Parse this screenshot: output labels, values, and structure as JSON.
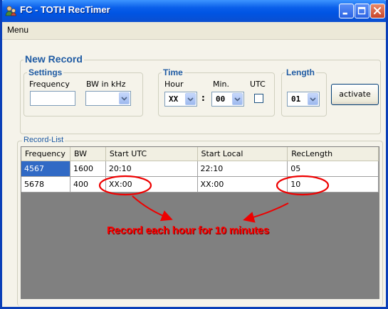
{
  "window": {
    "title": "FC - TOTH RecTimer"
  },
  "menu": {
    "label": "Menu"
  },
  "new_record": {
    "legend": "New Record",
    "settings": {
      "legend": "Settings",
      "frequency_label": "Frequency",
      "frequency_value": "",
      "bw_label": "BW in kHz",
      "bw_value": ""
    },
    "time": {
      "legend": "Time",
      "hour_label": "Hour",
      "hour_value": "XX",
      "min_label": "Min.",
      "min_value": "00",
      "separator": ":",
      "utc_label": "UTC",
      "utc_checked": false
    },
    "length": {
      "legend": "Length",
      "value": "01"
    },
    "activate_label": "activate"
  },
  "record_list": {
    "legend": "Record-List",
    "columns": [
      "Frequency",
      "BW",
      "Start UTC",
      "Start Local",
      "RecLength"
    ],
    "rows": [
      [
        "4567",
        "1600",
        "20:10",
        "22:10",
        "05"
      ],
      [
        "5678",
        "400",
        "XX:00",
        "XX:00",
        "10"
      ]
    ]
  },
  "annotation": {
    "text": "Record each hour for 10 minutes",
    "color": "#ff0000"
  },
  "colors": {
    "titlebar": "#0054e3",
    "selection": "#316ac5",
    "legend_text": "#1f5ba3",
    "grid_background": "#808080"
  }
}
